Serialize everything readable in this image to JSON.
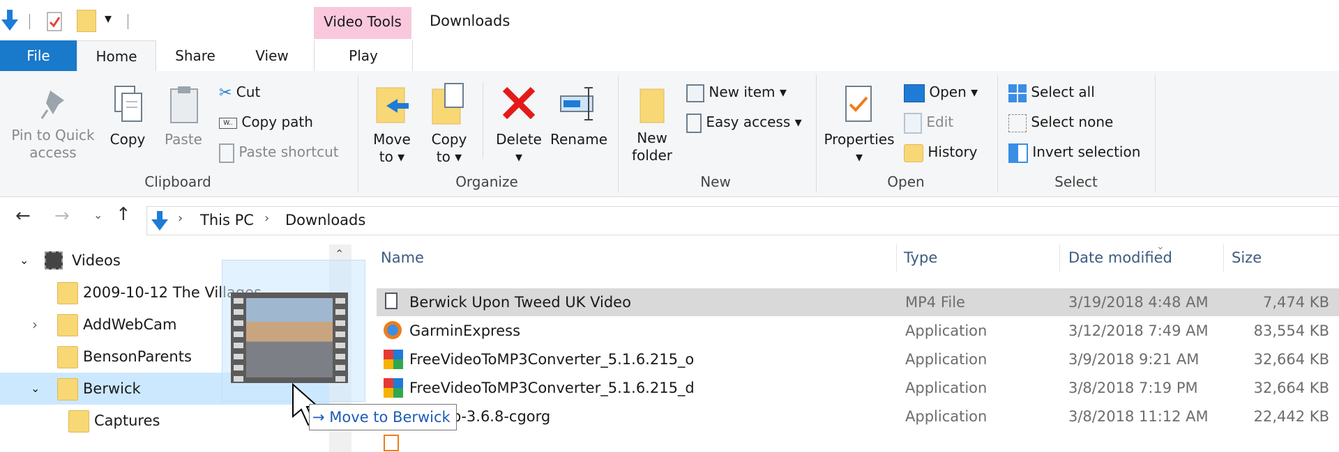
{
  "titlebar": {
    "contextual_tab_group": "Video Tools",
    "window_title": "Downloads"
  },
  "tabs": {
    "file": "File",
    "home": "Home",
    "share": "Share",
    "view": "View",
    "play": "Play"
  },
  "ribbon": {
    "clipboard": {
      "pin": "Pin to Quick",
      "pin2": "access",
      "copy": "Copy",
      "paste": "Paste",
      "cut": "Cut",
      "copy_path": "Copy path",
      "paste_shortcut": "Paste shortcut",
      "label": "Clipboard"
    },
    "organize": {
      "move_to": "Move",
      "move_to2": "to ▾",
      "copy_to": "Copy",
      "copy_to2": "to ▾",
      "delete": "Delete",
      "delete2": "▾",
      "rename": "Rename",
      "label": "Organize"
    },
    "new": {
      "new_folder": "New",
      "new_folder2": "folder",
      "new_item": "New item ▾",
      "easy_access": "Easy access ▾",
      "label": "New"
    },
    "open": {
      "properties": "Properties",
      "properties2": "▾",
      "open": "Open ▾",
      "edit": "Edit",
      "history": "History",
      "label": "Open"
    },
    "select": {
      "select_all": "Select all",
      "select_none": "Select none",
      "invert": "Invert selection",
      "label": "Select"
    }
  },
  "address": {
    "crumbs": [
      "This PC",
      "Downloads"
    ]
  },
  "nav": {
    "items": [
      {
        "label": "Videos"
      },
      {
        "label": "2009-10-12 The Villages"
      },
      {
        "label": "AddWebCam"
      },
      {
        "label": "BensonParents"
      },
      {
        "label": "Berwick"
      },
      {
        "label": "Captures"
      }
    ]
  },
  "columns": {
    "name": "Name",
    "type": "Type",
    "date": "Date modified",
    "size": "Size"
  },
  "files": [
    {
      "name": "Berwick Upon Tweed UK Video",
      "type": "MP4 File",
      "date": "3/19/2018 4:48 AM",
      "size": "7,474 KB"
    },
    {
      "name": "GarminExpress",
      "type": "Application",
      "date": "3/12/2018 7:49 AM",
      "size": "83,554 KB"
    },
    {
      "name": "FreeVideoToMP3Converter_5.1.6.215_o",
      "type": "Application",
      "date": "3/9/2018 9:21 AM",
      "size": "32,664 KB"
    },
    {
      "name": "FreeVideoToMP3Converter_5.1.6.215_d",
      "type": "Application",
      "date": "3/8/2018 7:19 PM",
      "size": "32,664 KB"
    },
    {
      "name": "p-3.6.8-cgorg",
      "type": "Application",
      "date": "3/8/2018 11:12 AM",
      "size": "22,442 KB"
    }
  ],
  "drag": {
    "tooltip": "Move to Berwick"
  },
  "colors": {
    "file_tab": "#1979ca",
    "video_tools": "#f9c8dc",
    "selected_row": "#d9d9d9",
    "nav_selected": "#cce8ff"
  }
}
